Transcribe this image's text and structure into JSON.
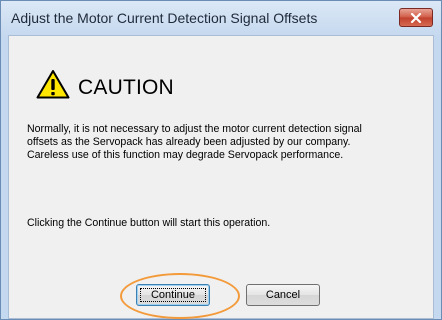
{
  "window": {
    "title": "Adjust the Motor Current Detection Signal Offsets",
    "close_icon": "close-x-icon",
    "close_color": "#c8432f"
  },
  "dialog": {
    "warning_icon": "warning-triangle-icon",
    "warning_color": "#ffe600",
    "heading": "CAUTION",
    "message_lines": [
      "Normally, it is not necessary to adjust the motor current detection signal",
      "offsets as the Servopack has already been adjusted by our company.",
      "Careless use of this function may degrade Servopack performance."
    ],
    "instruction": "Clicking the Continue button will start this operation."
  },
  "buttons": {
    "continue_label": "Continue",
    "cancel_label": "Cancel"
  },
  "annotation": {
    "highlight_color": "#f39a3a"
  }
}
